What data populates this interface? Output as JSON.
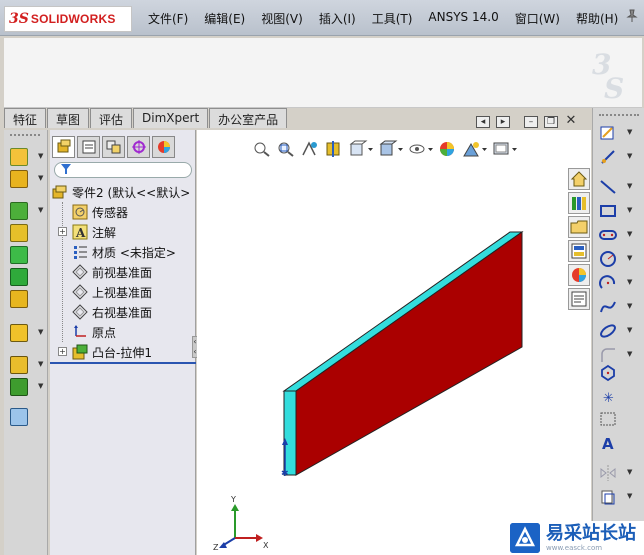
{
  "app": {
    "logo_prefix": "3S",
    "logo_text": "SOLIDWORKS"
  },
  "menu": [
    "文件(F)",
    "编辑(E)",
    "视图(V)",
    "插入(I)",
    "工具(T)",
    "ANSYS 14.0",
    "窗口(W)",
    "帮助(H)"
  ],
  "tabs": [
    "特征",
    "草图",
    "评估",
    "DimXpert",
    "办公室产品"
  ],
  "feature_tree": {
    "root": "零件2 (默认<<默认>",
    "items": [
      {
        "label": "传感器",
        "expandable": false
      },
      {
        "label": "注解",
        "expandable": true
      },
      {
        "label": "材质 <未指定>",
        "expandable": false
      },
      {
        "label": "前视基准面",
        "expandable": false
      },
      {
        "label": "上视基准面",
        "expandable": false
      },
      {
        "label": "右视基准面",
        "expandable": false
      },
      {
        "label": "原点",
        "expandable": false
      },
      {
        "label": "凸台-拉伸1",
        "expandable": true
      }
    ]
  },
  "triad": {
    "x": "X",
    "y": "Y",
    "z": "Z"
  },
  "model_colors": {
    "front": "#aa0000",
    "top_side": "#33dddd",
    "edge": "#222222"
  },
  "watermark": {
    "main": "易采站长站",
    "sub": "www.easck.com"
  }
}
